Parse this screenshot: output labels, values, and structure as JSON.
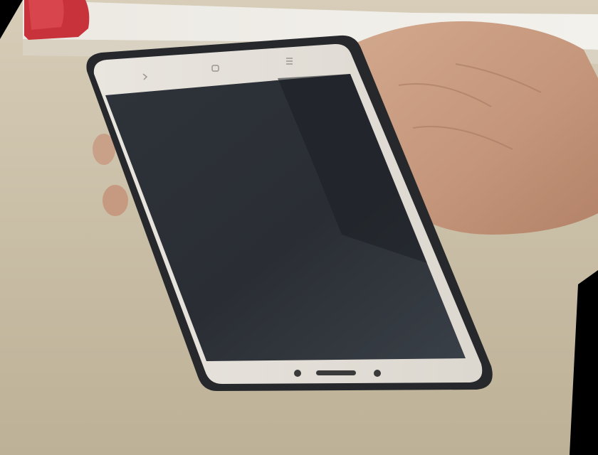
{
  "scene": {
    "description_name": "phone-held-in-hand-photo",
    "colors": {
      "background_black": "#000000",
      "table_surface": "#c9bea6",
      "wall_light": "#e9e6e0",
      "red_object": "#c8323a",
      "phone_case": "#26282b",
      "phone_bezel": "#e6e2dc",
      "screen_dark": "#2c3036",
      "skin": "#c89a7e"
    },
    "phone": {
      "navigation_icons": [
        "back-chevron-icon",
        "home-square-icon",
        "menu-lines-icon"
      ],
      "screen_state": "off"
    }
  }
}
